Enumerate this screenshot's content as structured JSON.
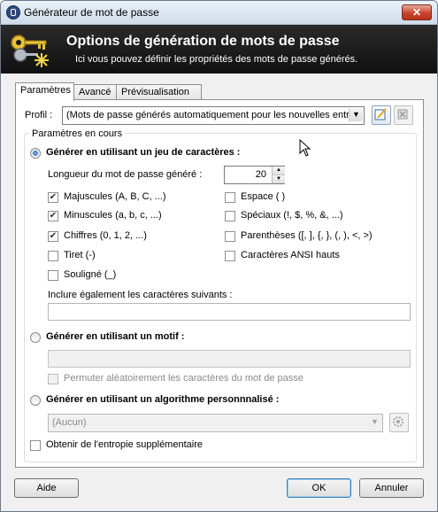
{
  "window": {
    "title": "Générateur de mot de passe",
    "close_glyph": "✕"
  },
  "banner": {
    "title": "Options de génération de mots de passe",
    "subtitle": "Ici vous pouvez définir les propriétés des mots de passe générés."
  },
  "tabs": [
    {
      "label": "Paramètres",
      "active": true
    },
    {
      "label": "Avancé",
      "active": false
    },
    {
      "label": "Prévisualisation",
      "active": false
    }
  ],
  "profile": {
    "label": "Profil :",
    "value": "(Mots de passe générés automatiquement pour les nouvelles entrée",
    "save_icon": "save-profile-icon",
    "delete_icon": "delete-profile-icon"
  },
  "group": {
    "caption": "Paramètres en cours"
  },
  "charset": {
    "radio_label": "Générer en utilisant un jeu de caractères :",
    "selected": true,
    "length_label": "Longueur du mot de passe généré :",
    "length_value": "20",
    "options": [
      {
        "label": "Majuscules (A, B, C, ...)",
        "checked": true
      },
      {
        "label": "Minuscules (a, b, c, ...)",
        "checked": true
      },
      {
        "label": "Chiffres (0, 1, 2, ...)",
        "checked": true
      },
      {
        "label": "Tiret (-)",
        "checked": false
      },
      {
        "label": "Souligné (_)",
        "checked": false
      },
      {
        "label": "Espace ( )",
        "checked": false
      },
      {
        "label": "Spéciaux (!, $, %, &, ...)",
        "checked": false
      },
      {
        "label": "Parenthèses ([, ], {, }, (, ), <, >)",
        "checked": false
      },
      {
        "label": "Caractères ANSI hauts",
        "checked": false
      }
    ],
    "include_label": "Inclure également les caractères suivants :",
    "include_value": ""
  },
  "pattern": {
    "radio_label": "Générer en utilisant un motif :",
    "selected": false,
    "value": "",
    "permute_label": "Permuter aléatoirement les caractères du mot de passe",
    "permute_checked": false
  },
  "custom": {
    "radio_label": "Générer en utilisant un algorithme personnnalisé :",
    "selected": false,
    "value": "(Aucun)",
    "settings_icon": "gear-icon"
  },
  "entropy": {
    "label": "Obtenir de l'entropie supplémentaire",
    "checked": false
  },
  "buttons": {
    "help": "Aide",
    "ok": "OK",
    "cancel": "Annuler"
  },
  "colors": {
    "banner_bg": "#161616",
    "accent": "#1f5fb3",
    "close": "#c9452d"
  }
}
